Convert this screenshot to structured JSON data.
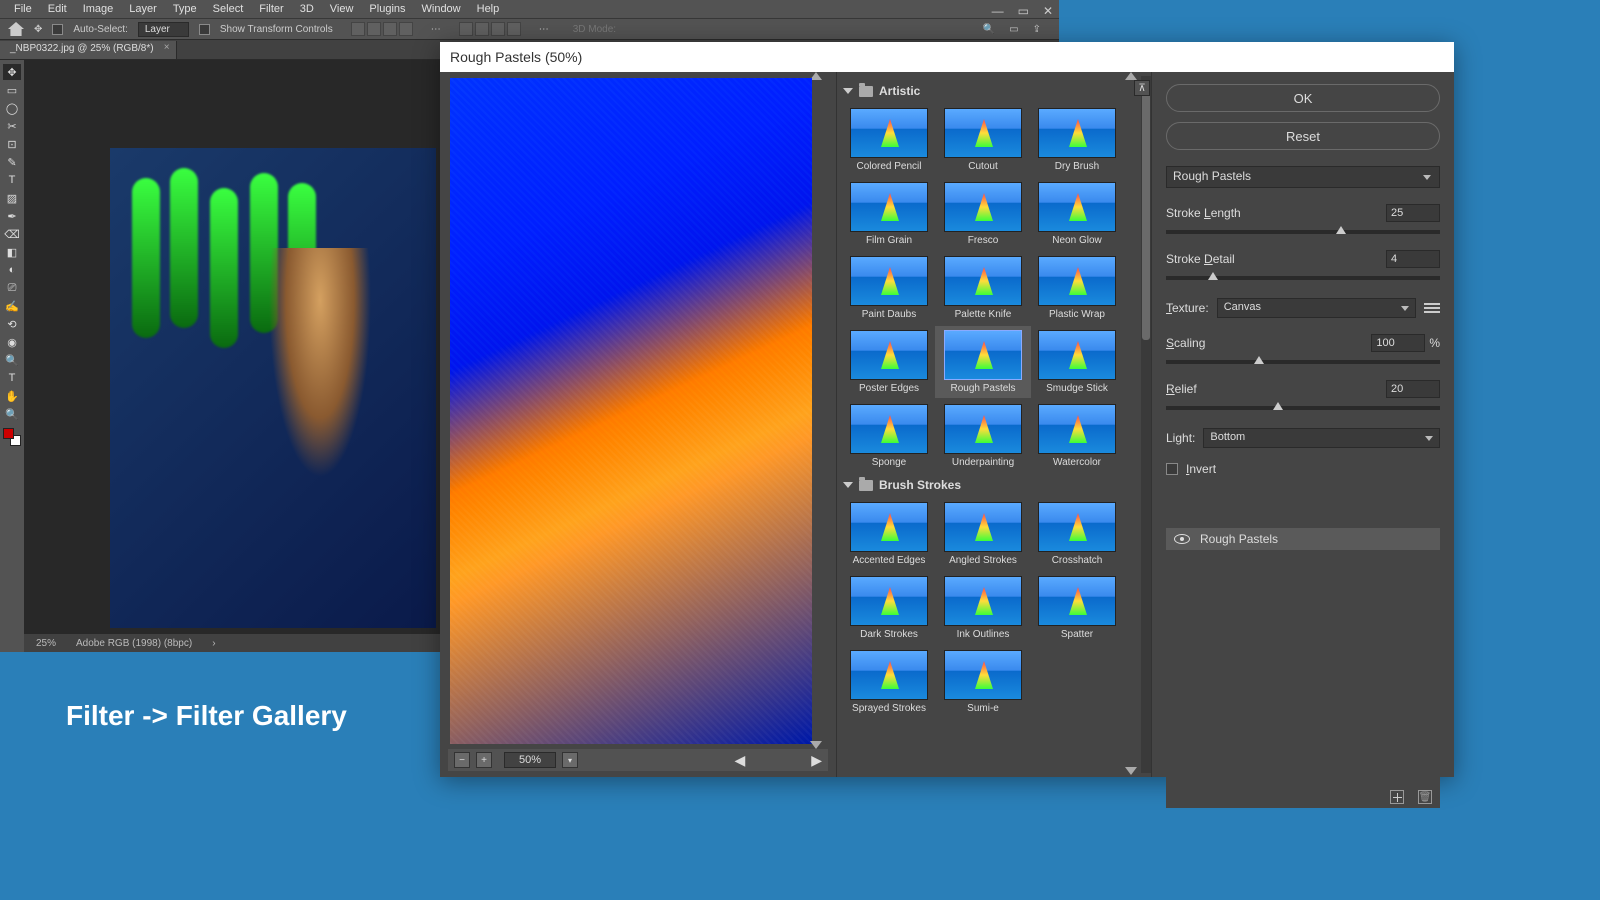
{
  "menubar": {
    "items": [
      "File",
      "Edit",
      "Image",
      "Layer",
      "Type",
      "Select",
      "Filter",
      "3D",
      "View",
      "Plugins",
      "Window",
      "Help"
    ]
  },
  "optbar": {
    "autoselect": "Auto-Select:",
    "layer": "Layer",
    "transform": "Show Transform Controls",
    "mode": "3D Mode:"
  },
  "tab": {
    "name": "_NBP0322.jpg @ 25% (RGB/8*)"
  },
  "statusbar": {
    "zoom": "25%",
    "info": "Adobe RGB (1998) (8bpc)"
  },
  "caption": "Filter -> Filter Gallery",
  "dialog": {
    "title": "Rough Pastels (50%)",
    "zoom": "50%",
    "ok": "OK",
    "reset": "Reset",
    "filter_name": "Rough Pastels",
    "stroke_length": {
      "label": "Stroke Length",
      "value": "25",
      "pos": 64
    },
    "stroke_detail": {
      "label": "Stroke Detail",
      "value": "4",
      "pos": 17
    },
    "texture_label": "Texture:",
    "texture_value": "Canvas",
    "scaling": {
      "label": "Scaling",
      "value": "100",
      "pos": 34,
      "pct": "%"
    },
    "relief": {
      "label": "Relief",
      "value": "20",
      "pos": 41
    },
    "light_label": "Light:",
    "light_value": "Bottom",
    "invert": "Invert",
    "layer": "Rough Pastels"
  },
  "categories": {
    "artistic": {
      "name": "Artistic",
      "thumbs": [
        "Colored Pencil",
        "Cutout",
        "Dry Brush",
        "Film Grain",
        "Fresco",
        "Neon Glow",
        "Paint Daubs",
        "Palette Knife",
        "Plastic Wrap",
        "Poster Edges",
        "Rough Pastels",
        "Smudge Stick",
        "Sponge",
        "Underpainting",
        "Watercolor"
      ]
    },
    "brush": {
      "name": "Brush Strokes",
      "thumbs": [
        "Accented Edges",
        "Angled Strokes",
        "Crosshatch",
        "Dark Strokes",
        "Ink Outlines",
        "Spatter",
        "Sprayed Strokes",
        "Sumi-e"
      ]
    }
  }
}
